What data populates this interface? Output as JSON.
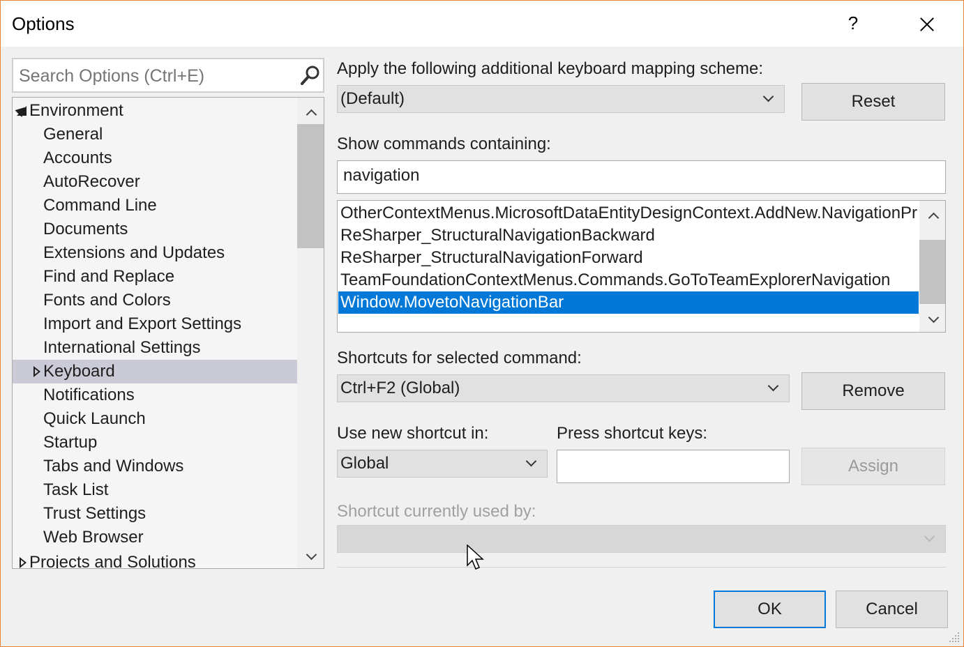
{
  "window": {
    "title": "Options",
    "help_label": "?"
  },
  "search": {
    "placeholder": "Search Options (Ctrl+E)"
  },
  "tree": {
    "root_environment": "Environment",
    "children": [
      "General",
      "Accounts",
      "AutoRecover",
      "Command Line",
      "Documents",
      "Extensions and Updates",
      "Find and Replace",
      "Fonts and Colors",
      "Import and Export Settings",
      "International Settings",
      "Keyboard",
      "Notifications",
      "Quick Launch",
      "Startup",
      "Tabs and Windows",
      "Task List",
      "Trust Settings",
      "Web Browser"
    ],
    "selected": "Keyboard",
    "root_projects": "Projects and Solutions"
  },
  "keyboard": {
    "mapping_label": "Apply the following additional keyboard mapping scheme:",
    "mapping_value": "(Default)",
    "reset_label": "Reset",
    "show_commands_label": "Show commands containing:",
    "show_commands_value": "navigation",
    "commands": [
      "OtherContextMenus.MicrosoftDataEntityDesignContext.AddNew.NavigationPr",
      "ReSharper_StructuralNavigationBackward",
      "ReSharper_StructuralNavigationForward",
      "TeamFoundationContextMenus.Commands.GoToTeamExplorerNavigation",
      "Window.MovetoNavigationBar"
    ],
    "selected_command": "Window.MovetoNavigationBar",
    "shortcuts_label": "Shortcuts for selected command:",
    "shortcuts_value": "Ctrl+F2 (Global)",
    "remove_label": "Remove",
    "use_new_label": "Use new shortcut in:",
    "use_new_value": "Global",
    "press_keys_label": "Press shortcut keys:",
    "press_keys_value": "",
    "assign_label": "Assign",
    "used_by_label": "Shortcut currently used by:",
    "used_by_value": ""
  },
  "footer": {
    "ok_label": "OK",
    "cancel_label": "Cancel"
  },
  "colors": {
    "selection": "#0078d7",
    "tree_selection": "#cbcbd7",
    "window_border": "#e8833a"
  }
}
